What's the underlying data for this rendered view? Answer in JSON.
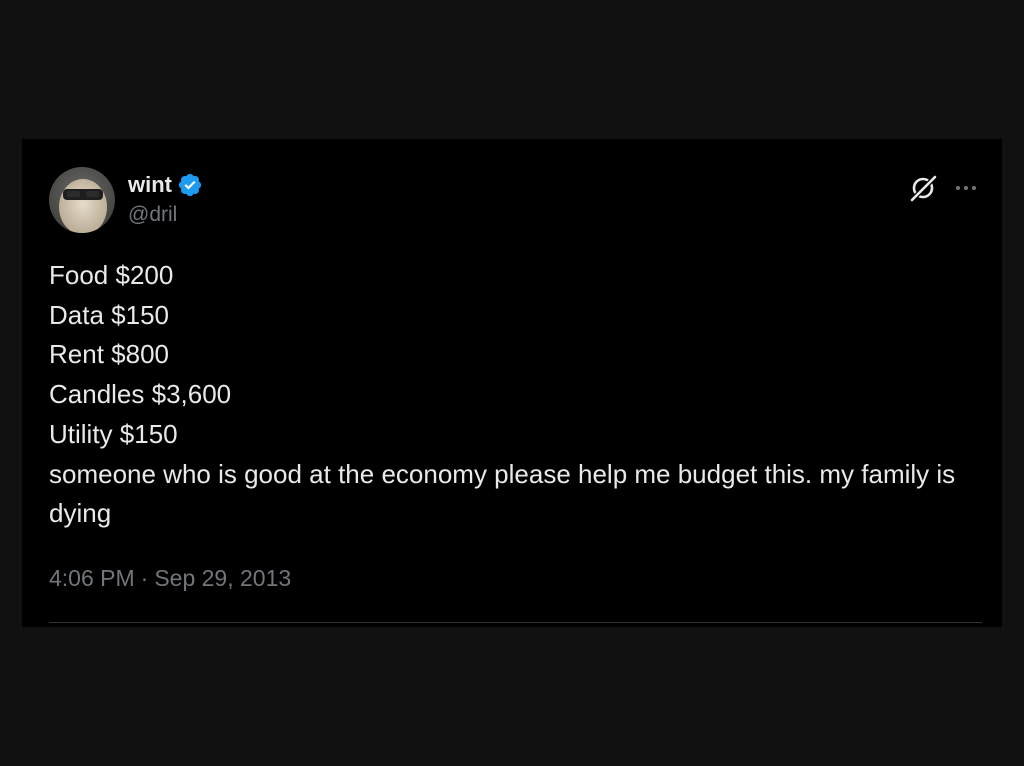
{
  "tweet": {
    "author": {
      "display_name": "wint",
      "handle": "@dril",
      "verified": true,
      "verified_color": "#1d9bf0"
    },
    "lines": [
      "Food $200",
      "Data $150",
      "Rent $800",
      "Candles $3,600",
      "Utility $150"
    ],
    "paragraph": "someone who is good at the economy please help me budget this. my family is dying",
    "time": "4:06 PM",
    "separator": "·",
    "date": "Sep 29, 2013"
  },
  "icons": {
    "grok": "grok-icon",
    "more": "more-icon",
    "verified": "verified-badge-icon"
  }
}
